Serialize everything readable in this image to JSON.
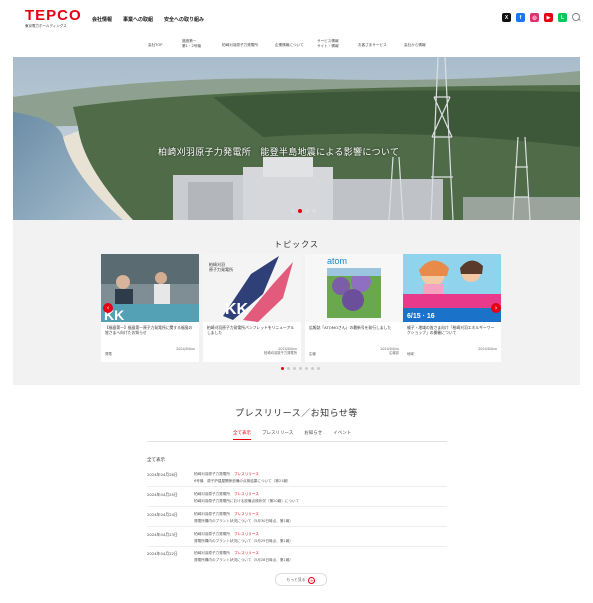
{
  "header": {
    "logo_text": "TEPCO",
    "logo_sub": "東京電力ホールディングス",
    "nav": [
      "会社情報",
      "事業への取組",
      "安全への取り組み"
    ],
    "subnav": [
      {
        "l1": "会社TOP",
        "l2": ""
      },
      {
        "l1": "福島第一",
        "l2": "第1・2号機"
      },
      {
        "l1": "柏崎刈羽原子力発電所",
        "l2": ""
      },
      {
        "l1": "企業情報について",
        "l2": ""
      },
      {
        "l1": "サービス情報",
        "l2": "サイト・情報"
      },
      {
        "l1": "お客さまサービス",
        "l2": ""
      },
      {
        "l1": "会社から情報",
        "l2": ""
      }
    ],
    "social_icons": [
      {
        "name": "x-icon",
        "glyph": "X",
        "color": "#111111"
      },
      {
        "name": "facebook-icon",
        "glyph": "f",
        "color": "#1877f2"
      },
      {
        "name": "instagram-icon",
        "glyph": "◎",
        "color": "#e1306c"
      },
      {
        "name": "youtube-icon",
        "glyph": "▶",
        "color": "#e60012"
      },
      {
        "name": "line-icon",
        "glyph": "L",
        "color": "#06c755"
      }
    ]
  },
  "hero": {
    "caption": "柏崎刈羽原子力発電所　能登半島地震による影響について",
    "slides": 4,
    "active_slide": 1
  },
  "topics": {
    "title": "トピックス",
    "cards": [
      {
        "text": "【福島第一】福島第一原子力発電所に関する福島の皆さまへ向けたお知らせ",
        "meta_left": "発電",
        "meta_right": "2024/04/xx"
      },
      {
        "text": "柏崎刈羽原子力発電所パンフレットをリニューアルしました",
        "meta_left": "",
        "meta_right": "2024/04/xx\n柏崎刈羽原子力発電所"
      },
      {
        "text": "広報誌「ATOMOさん」の最新号を発行しました",
        "meta_left": "広報",
        "meta_right": "2024/04/xx\n広報誌"
      },
      {
        "text": "親子・地域の皆さま向け「柏崎刈羽エネルギーワークショップ」の開催について",
        "meta_left": "地域",
        "meta_right": "2024/04/xx"
      }
    ],
    "dots": 7,
    "active_dot": 0
  },
  "press": {
    "title": "プレスリリース／お知らせ等",
    "tabs": [
      "全て表示",
      "プレスリリース",
      "お知らせ",
      "イベント"
    ],
    "active_tab": 0,
    "list_head": "全て表示",
    "rows": [
      {
        "date": "2024年04月26日",
        "tags": "柏崎刈羽原子力発電所",
        "tag": "プレスリリース",
        "text": "6号機　原子炉建屋関係設備の点検結果について（第21報）"
      },
      {
        "date": "2024年04月25日",
        "tags": "柏崎刈羽原子力発電所",
        "tag": "プレスリリース",
        "text": "柏崎刈羽原子力発電所における設備点検状況（第20報）について"
      },
      {
        "date": "2024年04月24日",
        "tags": "柏崎刈羽原子力発電所",
        "tag": "プレスリリース",
        "text": "発電所構内のプラント状況について（5月30日時点、第1報）"
      },
      {
        "date": "2024年04月23日",
        "tags": "柏崎刈羽原子力発電所",
        "tag": "プレスリリース",
        "text": "発電所構内のプラント状況について（5月29日時点、第1報）"
      },
      {
        "date": "2024年04月22日",
        "tags": "柏崎刈羽原子力発電所",
        "tag": "プレスリリース",
        "text": "発電所構内のプラント状況について（5月28日時点、第1報）"
      }
    ],
    "more_label": "もっと見る"
  }
}
